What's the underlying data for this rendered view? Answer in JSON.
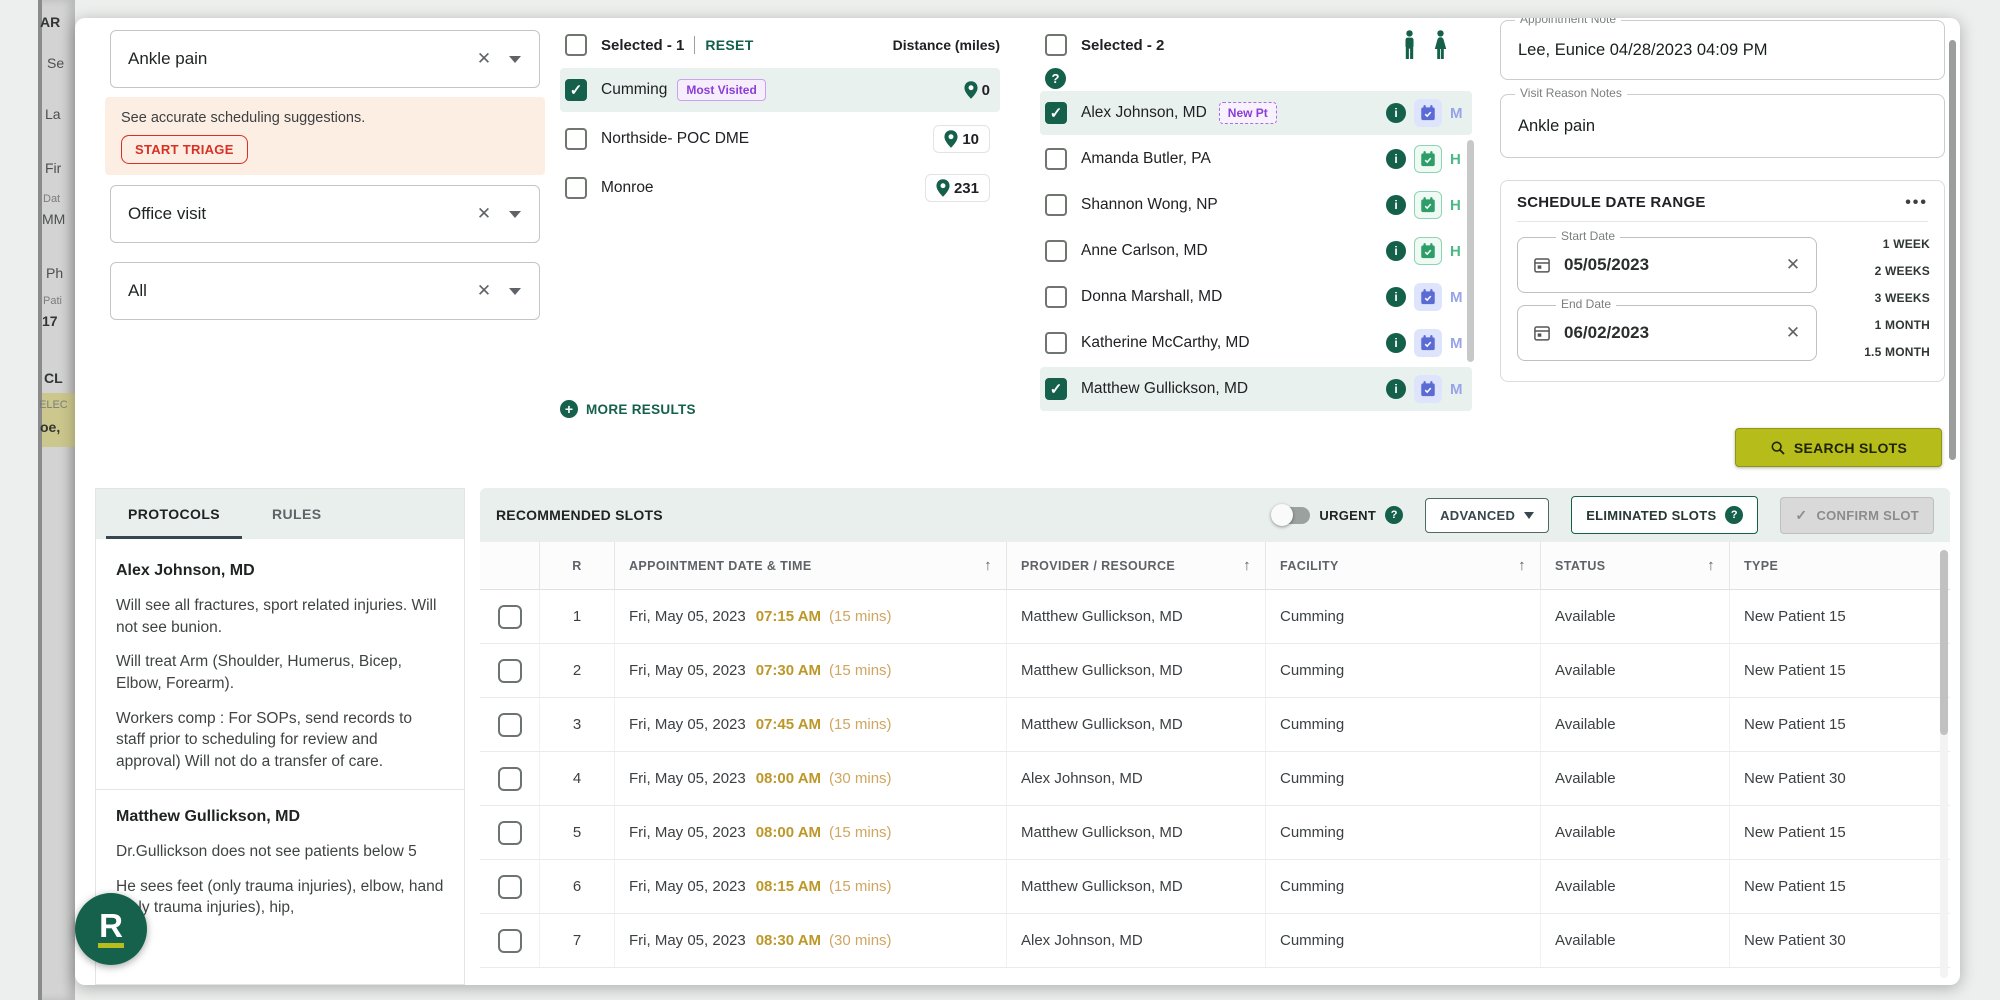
{
  "colors": {
    "primary_green": "#15604b",
    "row_highlight": "#e9f1ee",
    "bar_green": "#e8efec",
    "olive_button": "#b6bd1b",
    "purple_badge": "#8b3dd6",
    "amber_time": "#bd9727",
    "red_triage": "#d93025",
    "blue_calendar": "#5b6bd5",
    "green_calendar": "#2e9e68"
  },
  "page": {
    "background_fragments": [
      "AR",
      "Se",
      "La",
      "Fir",
      "Dat",
      "MM",
      "Ph",
      "Pati",
      "17",
      "CL",
      "ELEC",
      "oe,"
    ]
  },
  "filters": {
    "reason_value": "Ankle pain",
    "triage_message": "See accurate scheduling suggestions.",
    "triage_button": "START TRIAGE",
    "visit_type_value": "Office visit",
    "department_value": "All"
  },
  "locations": {
    "selected_label": "Selected  - 1",
    "reset": "RESET",
    "distance_header": "Distance (miles)",
    "more_results": "MORE RESULTS",
    "items": [
      {
        "name": "Cumming",
        "badge": "Most Visited",
        "distance": "0"
      },
      {
        "name": "Northside- POC DME",
        "distance": "10"
      },
      {
        "name": "Monroe",
        "distance": "231"
      }
    ]
  },
  "providers": {
    "selected_label": "Selected  - 2",
    "items": [
      {
        "name": "Alex Johnson, MD",
        "badge": "New Pt",
        "cal_letter": "M"
      },
      {
        "name": "Amanda Butler, PA",
        "cal_letter": "H"
      },
      {
        "name": "Shannon Wong, NP",
        "cal_letter": "H"
      },
      {
        "name": "Anne Carlson, MD",
        "cal_letter": "H"
      },
      {
        "name": "Donna Marshall, MD",
        "cal_letter": "M"
      },
      {
        "name": "Katherine McCarthy, MD",
        "cal_letter": "M"
      },
      {
        "name": "Matthew Gullickson, MD",
        "cal_letter": "M"
      }
    ]
  },
  "notes": {
    "appointment_note_label": "Appointment Note",
    "appointment_note_value": "Lee, Eunice 04/28/2023 04:09 PM",
    "visit_reason_label": "Visit Reason Notes",
    "visit_reason_value": "Ankle pain"
  },
  "date_range": {
    "title": "SCHEDULE DATE RANGE",
    "start_label": "Start Date",
    "start_value": "05/05/2023",
    "end_label": "End Date",
    "end_value": "06/02/2023",
    "quick_options": [
      "1 WEEK",
      "2 WEEKS",
      "3 WEEKS",
      "1 MONTH",
      "1.5 MONTH"
    ]
  },
  "actions": {
    "search_slots": "SEARCH SLOTS"
  },
  "protocols": {
    "tab_protocols": "PROTOCOLS",
    "tab_rules": "RULES",
    "sections": [
      {
        "title": "Alex Johnson, MD",
        "p1": "Will see all fractures, sport related injuries. Will not see bunion.",
        "p2": "Will treat Arm (Shoulder, Humerus, Bicep, Elbow, Forearm).",
        "p3": "Workers comp : For SOPs, send records to staff prior to scheduling for review and approval) Will not do a transfer of care."
      },
      {
        "title": "Matthew Gullickson, MD",
        "p1": "Dr.Gullickson does not see patients below 5",
        "p2": "He sees feet (only trauma injuries), elbow, hand (only trauma injuries), hip,"
      }
    ]
  },
  "slots": {
    "title": "RECOMMENDED SLOTS",
    "urgent": "URGENT",
    "advanced": "ADVANCED",
    "eliminated": "ELIMINATED SLOTS",
    "confirm": "CONFIRM SLOT",
    "columns": {
      "r": "R",
      "datetime": "APPOINTMENT DATE & TIME",
      "provider": "PROVIDER / RESOURCE",
      "facility": "FACILITY",
      "status": "STATUS",
      "type": "TYPE"
    },
    "rows": [
      {
        "r": "1",
        "date": "Fri, May 05, 2023",
        "time": "07:15 AM",
        "duration": "(15 mins)",
        "provider": "Matthew Gullickson, MD",
        "facility": "Cumming",
        "status": "Available",
        "type": "New Patient 15"
      },
      {
        "r": "2",
        "date": "Fri, May 05, 2023",
        "time": "07:30 AM",
        "duration": "(15 mins)",
        "provider": "Matthew Gullickson, MD",
        "facility": "Cumming",
        "status": "Available",
        "type": "New Patient 15"
      },
      {
        "r": "3",
        "date": "Fri, May 05, 2023",
        "time": "07:45 AM",
        "duration": "(15 mins)",
        "provider": "Matthew Gullickson, MD",
        "facility": "Cumming",
        "status": "Available",
        "type": "New Patient 15"
      },
      {
        "r": "4",
        "date": "Fri, May 05, 2023",
        "time": "08:00 AM",
        "duration": "(30 mins)",
        "provider": "Alex Johnson, MD",
        "facility": "Cumming",
        "status": "Available",
        "type": "New Patient 30"
      },
      {
        "r": "5",
        "date": "Fri, May 05, 2023",
        "time": "08:00 AM",
        "duration": "(15 mins)",
        "provider": "Matthew Gullickson, MD",
        "facility": "Cumming",
        "status": "Available",
        "type": "New Patient 15"
      },
      {
        "r": "6",
        "date": "Fri, May 05, 2023",
        "time": "08:15 AM",
        "duration": "(15 mins)",
        "provider": "Matthew Gullickson, MD",
        "facility": "Cumming",
        "status": "Available",
        "type": "New Patient 15"
      },
      {
        "r": "7",
        "date": "Fri, May 05, 2023",
        "time": "08:30 AM",
        "duration": "(30 mins)",
        "provider": "Alex Johnson, MD",
        "facility": "Cumming",
        "status": "Available",
        "type": "New Patient 30"
      }
    ]
  },
  "fab": {
    "letter": "R"
  }
}
